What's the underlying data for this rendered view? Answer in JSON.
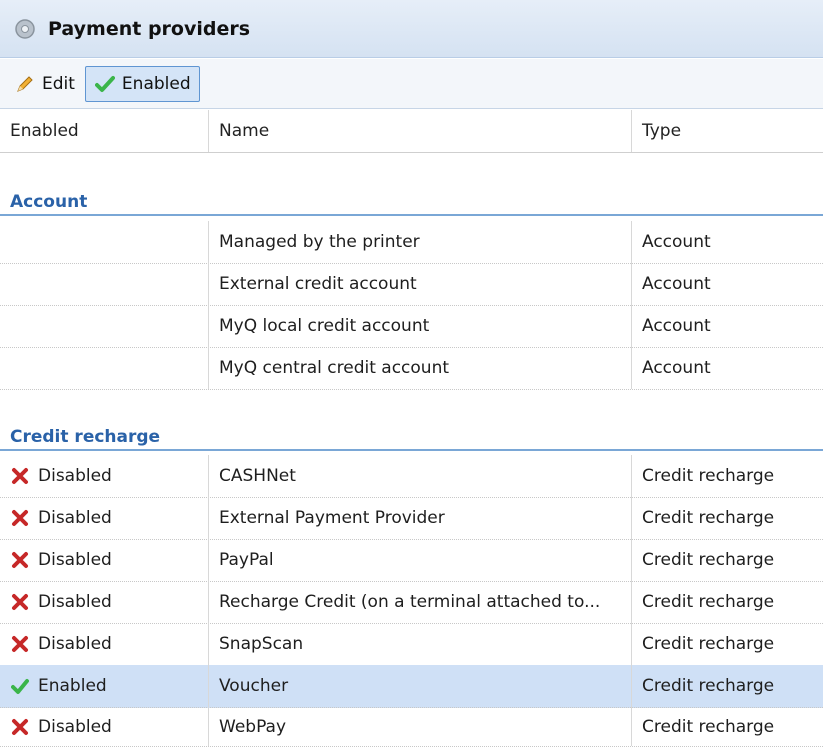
{
  "panel": {
    "title": "Payment providers",
    "icon": "gear-icon"
  },
  "toolbar": {
    "edit_label": "Edit",
    "enabled_label": "Enabled"
  },
  "columns": {
    "enabled": "Enabled",
    "name": "Name",
    "type": "Type"
  },
  "groups": [
    {
      "label": "Account",
      "rows": [
        {
          "status": "",
          "name": "Managed by the printer",
          "type": "Account"
        },
        {
          "status": "",
          "name": "External credit account",
          "type": "Account"
        },
        {
          "status": "",
          "name": "MyQ local credit account",
          "type": "Account"
        },
        {
          "status": "",
          "name": "MyQ central credit account",
          "type": "Account"
        }
      ]
    },
    {
      "label": "Credit recharge",
      "rows": [
        {
          "status": "Disabled",
          "name": "CASHNet",
          "type": "Credit recharge"
        },
        {
          "status": "Disabled",
          "name": "External Payment Provider",
          "type": "Credit recharge"
        },
        {
          "status": "Disabled",
          "name": "PayPal",
          "type": "Credit recharge"
        },
        {
          "status": "Disabled",
          "name": "Recharge Credit (on a terminal attached to...",
          "type": "Credit recharge"
        },
        {
          "status": "Disabled",
          "name": "SnapScan",
          "type": "Credit recharge"
        },
        {
          "status": "Enabled",
          "name": "Voucher",
          "type": "Credit recharge",
          "selected": true
        },
        {
          "status": "Disabled",
          "name": "WebPay",
          "type": "Credit recharge"
        }
      ]
    }
  ],
  "colors": {
    "accent": "#2a62a8",
    "selection": "#cfe0f6",
    "disabled_icon": "#c62828",
    "enabled_icon": "#3bb54a"
  }
}
